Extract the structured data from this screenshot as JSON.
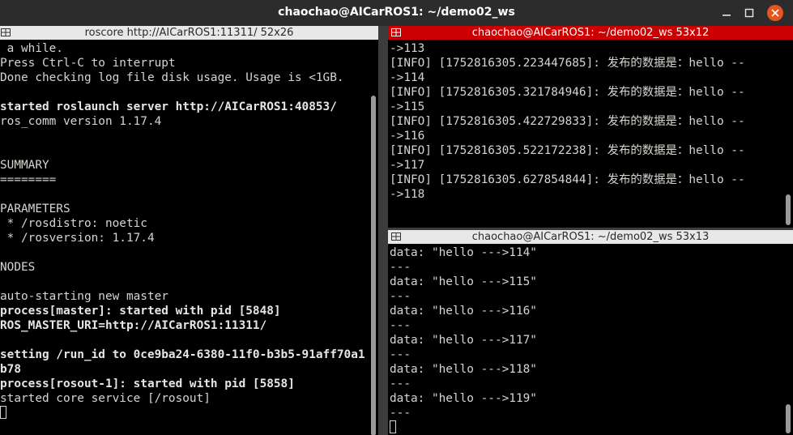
{
  "window": {
    "title": "chaochao@AICarROS1: ~/demo02_ws",
    "controls": {
      "minimize": "–",
      "maximize": "□",
      "close": "✕"
    }
  },
  "panes": {
    "left": {
      "title": "roscore http://AICarROS1:11311/ 52x26",
      "lines": [
        {
          "text": " a while.",
          "bold": false
        },
        {
          "text": "Press Ctrl-C to interrupt",
          "bold": false
        },
        {
          "text": "Done checking log file disk usage. Usage is <1GB.",
          "bold": false
        },
        {
          "text": "",
          "bold": false
        },
        {
          "text": "started roslaunch server http://AICarROS1:40853/",
          "bold": true
        },
        {
          "text": "ros_comm version 1.17.4",
          "bold": false
        },
        {
          "text": "",
          "bold": false
        },
        {
          "text": "",
          "bold": false
        },
        {
          "text": "SUMMARY",
          "bold": false
        },
        {
          "text": "========",
          "bold": false
        },
        {
          "text": "",
          "bold": false
        },
        {
          "text": "PARAMETERS",
          "bold": false
        },
        {
          "text": " * /rosdistro: noetic",
          "bold": false
        },
        {
          "text": " * /rosversion: 1.17.4",
          "bold": false
        },
        {
          "text": "",
          "bold": false
        },
        {
          "text": "NODES",
          "bold": false
        },
        {
          "text": "",
          "bold": false
        },
        {
          "text": "auto-starting new master",
          "bold": false
        },
        {
          "text": "process[master]: started with pid [5848]",
          "bold": true
        },
        {
          "text": "ROS_MASTER_URI=http://AICarROS1:11311/",
          "bold": true
        },
        {
          "text": "",
          "bold": false
        },
        {
          "text": "setting /run_id to 0ce9ba24-6380-11f0-b3b5-91aff70a1",
          "bold": true
        },
        {
          "text": "b78",
          "bold": true
        },
        {
          "text": "process[rosout-1]: started with pid [5858]",
          "bold": true
        },
        {
          "text": "started core service [/rosout]",
          "bold": false
        }
      ]
    },
    "top_right": {
      "title": "chaochao@AICarROS1: ~/demo02_ws 53x12",
      "lines": [
        "->113",
        "[INFO] [1752816305.223447685]: 发布的数据是：hello --",
        "->114",
        "[INFO] [1752816305.321784946]: 发布的数据是：hello --",
        "->115",
        "[INFO] [1752816305.422729833]: 发布的数据是：hello --",
        "->116",
        "[INFO] [1752816305.522172238]: 发布的数据是：hello --",
        "->117",
        "[INFO] [1752816305.627854844]: 发布的数据是：hello --",
        "->118"
      ]
    },
    "bottom_right": {
      "title": "chaochao@AICarROS1: ~/demo02_ws 53x13",
      "lines": [
        "data: \"hello --->114\"",
        "---",
        "data: \"hello --->115\"",
        "---",
        "data: \"hello --->116\"",
        "---",
        "data: \"hello --->117\"",
        "---",
        "data: \"hello --->118\"",
        "---",
        "data: \"hello --->119\"",
        "---"
      ]
    }
  },
  "icons": {
    "split": "split-terminal-icon"
  },
  "colors": {
    "active_header": "#cc0000",
    "inactive_header": "#e8e8e8",
    "terminal_bg": "#000000",
    "terminal_fg": "#d3d7cf"
  }
}
